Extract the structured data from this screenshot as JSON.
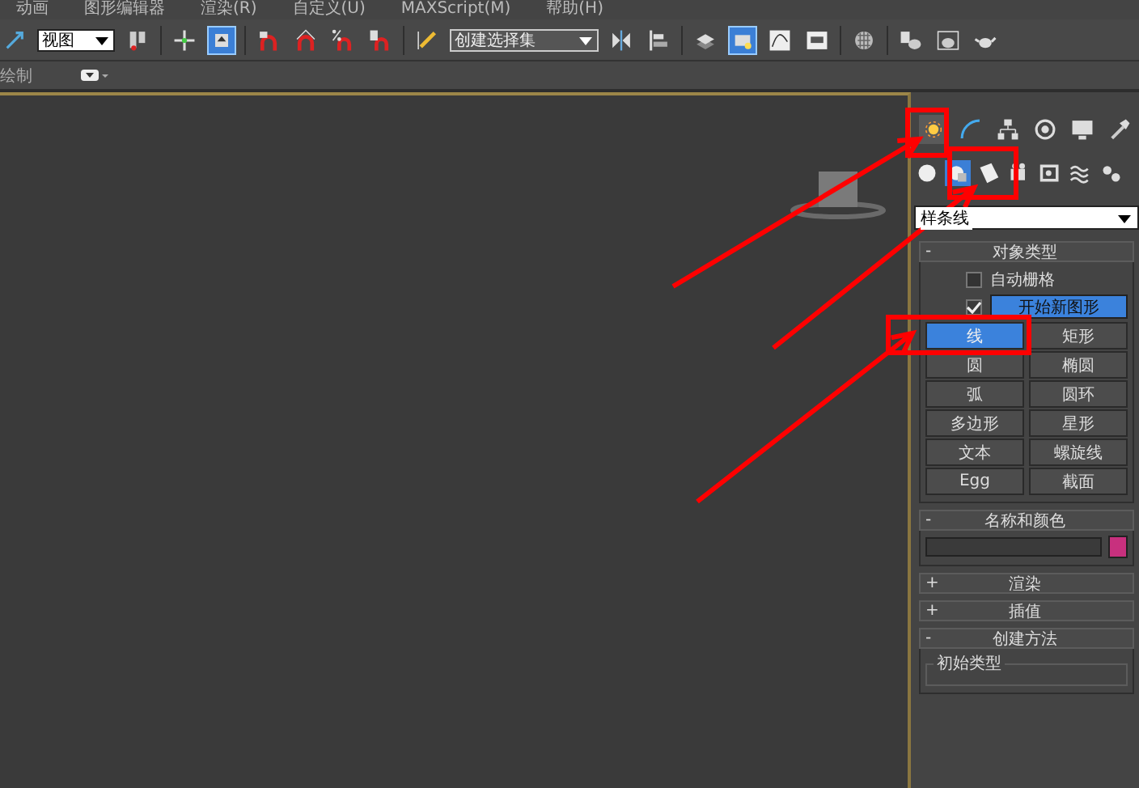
{
  "menu_bar": [
    {
      "label": "动画"
    },
    {
      "label": "图形编辑器"
    },
    {
      "label": "渲染(R)"
    },
    {
      "label": "自定义(U)"
    },
    {
      "label": "MAXScript(M)"
    },
    {
      "label": "帮助(H)"
    }
  ],
  "toolbar": {
    "view_dropdown": "视图",
    "selection_set_dropdown": "创建选择集"
  },
  "ribbon_bar": {
    "label": "绘制"
  },
  "command_panel": {
    "tabs": [
      {
        "selected": true
      },
      {
        "selected": false
      },
      {
        "selected": false
      },
      {
        "selected": false
      },
      {
        "selected": false
      },
      {
        "selected": false
      }
    ],
    "categories": [
      {
        "selected": false
      },
      {
        "selected": true
      },
      {
        "selected": false
      },
      {
        "selected": false
      },
      {
        "selected": false
      },
      {
        "selected": false
      },
      {
        "selected": false
      }
    ],
    "type_dropdown": "样条线",
    "rollouts": [
      {
        "kind": "object_type",
        "sign": "-",
        "title": "对象类型",
        "auto_grid": {
          "label": "自动栅格",
          "checked": false
        },
        "start_new_shape": {
          "label": "开始新图形",
          "checked": true
        },
        "buttons": [
          {
            "label": "线",
            "selected": true
          },
          {
            "label": "矩形",
            "selected": false
          },
          {
            "label": "圆",
            "selected": false
          },
          {
            "label": "椭圆",
            "selected": false
          },
          {
            "label": "弧",
            "selected": false
          },
          {
            "label": "圆环",
            "selected": false
          },
          {
            "label": "多边形",
            "selected": false
          },
          {
            "label": "星形",
            "selected": false
          },
          {
            "label": "文本",
            "selected": false
          },
          {
            "label": "螺旋线",
            "selected": false
          },
          {
            "label": "Egg",
            "selected": false
          },
          {
            "label": "截面",
            "selected": false
          }
        ]
      },
      {
        "kind": "name_color",
        "sign": "-",
        "title": "名称和颜色",
        "color": "#c8307e"
      },
      {
        "kind": "collapsed",
        "sign": "+",
        "title": "渲染"
      },
      {
        "kind": "collapsed",
        "sign": "+",
        "title": "插值"
      },
      {
        "kind": "creation_method",
        "sign": "-",
        "title": "创建方法",
        "group": "初始类型"
      }
    ]
  }
}
